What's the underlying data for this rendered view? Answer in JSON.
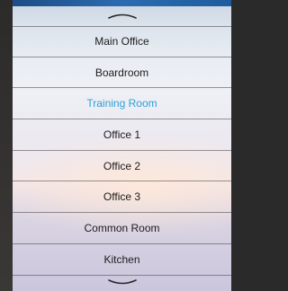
{
  "rooms": [
    {
      "label": "Main Office",
      "active": false
    },
    {
      "label": "Boardroom",
      "active": false
    },
    {
      "label": "Training Room",
      "active": true
    },
    {
      "label": "Office 1",
      "active": false
    },
    {
      "label": "Office 2",
      "active": false
    },
    {
      "label": "Office 3",
      "active": false
    },
    {
      "label": "Common Room",
      "active": false
    },
    {
      "label": "Kitchen",
      "active": false
    }
  ],
  "colors": {
    "active_text": "#2f9fd8",
    "text": "#1c1c1c",
    "top_strip": "#2b6cb0"
  },
  "icons": {
    "scroll_up": "chevron-up-icon",
    "scroll_down": "chevron-down-icon"
  }
}
